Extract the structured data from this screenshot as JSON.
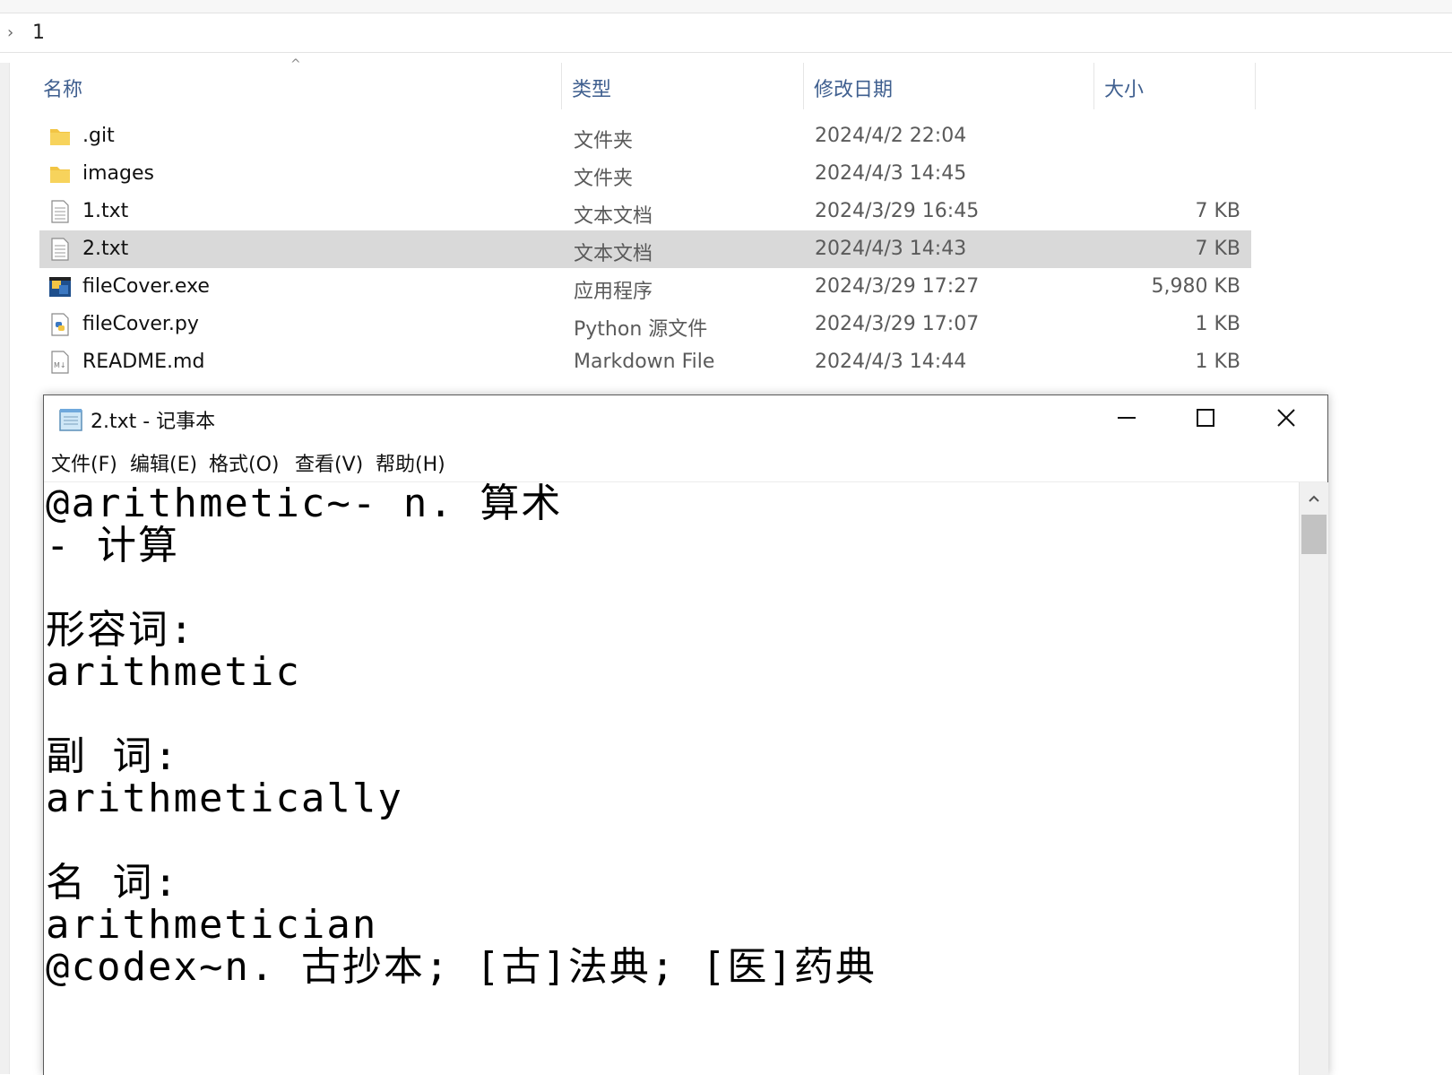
{
  "explorer": {
    "address": {
      "path": "1"
    },
    "columns": {
      "name": "名称",
      "type": "类型",
      "modified": "修改日期",
      "size": "大小"
    },
    "files": [
      {
        "name": ".git",
        "type": "文件夹",
        "modified": "2024/4/2 22:04",
        "size": "",
        "icon": "folder-icon"
      },
      {
        "name": "images",
        "type": "文件夹",
        "modified": "2024/4/3 14:45",
        "size": "",
        "icon": "folder-icon"
      },
      {
        "name": "1.txt",
        "type": "文本文档",
        "modified": "2024/3/29 16:45",
        "size": "7 KB",
        "icon": "text-file-icon"
      },
      {
        "name": "2.txt",
        "type": "文本文档",
        "modified": "2024/4/3 14:43",
        "size": "7 KB",
        "icon": "text-file-icon",
        "selected": true
      },
      {
        "name": "fileCover.exe",
        "type": "应用程序",
        "modified": "2024/3/29 17:27",
        "size": "5,980 KB",
        "icon": "python-exe-icon"
      },
      {
        "name": "fileCover.py",
        "type": "Python 源文件",
        "modified": "2024/3/29 17:07",
        "size": "1 KB",
        "icon": "python-file-icon"
      },
      {
        "name": "README.md",
        "type": "Markdown File",
        "modified": "2024/4/3 14:44",
        "size": "1 KB",
        "icon": "markdown-file-icon"
      }
    ]
  },
  "notepad": {
    "title": "2.txt - 记事本",
    "menu": [
      "文件(F)",
      "编辑(E)",
      "格式(O)",
      "查看(V)",
      "帮助(H)"
    ],
    "lines": [
      "@arithmetic~- n. 算术",
      "- 计算",
      "",
      "形容词:",
      "arithmetic",
      "",
      "副 词:",
      "arithmetically",
      "",
      "名 词:",
      "arithmetician",
      "@codex~n. 古抄本; [古]法典; [医]药典"
    ]
  },
  "colors": {
    "header_text": "#3f5f8f",
    "selected_row": "#d9d9d9",
    "folder": "#f2c544"
  }
}
